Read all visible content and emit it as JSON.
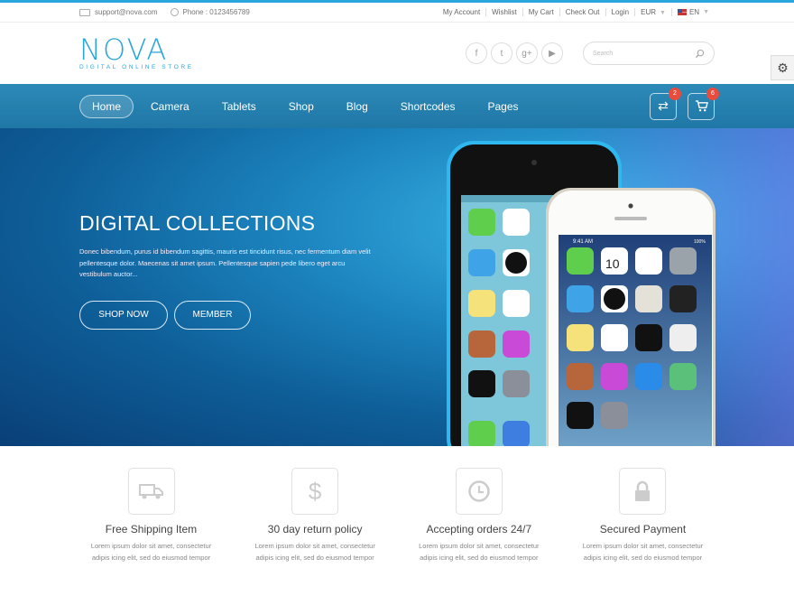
{
  "topbar": {
    "email": "support@nova.com",
    "phone": "Phone : 0123456789",
    "links": [
      "My Account",
      "Wishlist",
      "My Cart",
      "Check Out",
      "Login"
    ],
    "currency": "EUR",
    "language": "EN"
  },
  "logo": {
    "brand": "NOVA",
    "tagline": "DIGITAL ONLINE STORE"
  },
  "search": {
    "placeholder": "Search"
  },
  "nav": {
    "items": [
      "Home",
      "Camera",
      "Tablets",
      "Shop",
      "Blog",
      "Shortcodes",
      "Pages"
    ],
    "compare_count": "2",
    "cart_count": "6"
  },
  "hero": {
    "title": "DIGITAL COLLECTIONS",
    "text": "Donec bibendum, purus id bibendum sagittis, mauris est tincidunt risus, nec fermentum diam velit pellentesque dolor. Maecenas sit amet ipsum. Pellentesque sapien pede libero eget arcu vestibulum auctor...",
    "btn1": "SHOP NOW",
    "btn2": "MEMBER"
  },
  "phone_screen": {
    "time": "9:41 AM",
    "battery": "100%",
    "date_number": "10",
    "apps": [
      "Messages",
      "Calendar",
      "Photos",
      "Camera",
      "Weather",
      "Clock",
      "Maps",
      "Videos",
      "Notes",
      "Reminders",
      "Stocks",
      "Game Center",
      "Newsstand",
      "iTunes Store",
      "App Store",
      "Passbook",
      "Compass",
      "Settings"
    ]
  },
  "features": [
    {
      "title": "Free Shipping Item",
      "text": "Lorem ipsum dolor sit amet, consectetur adipis icing elit, sed do eiusmod tempor",
      "icon": "truck-icon"
    },
    {
      "title": "30 day return policy",
      "text": "Lorem ipsum dolor sit amet, consectetur adipis icing elit, sed do eiusmod tempor",
      "icon": "dollar-icon"
    },
    {
      "title": "Accepting orders 24/7",
      "text": "Lorem ipsum dolor sit amet, consectetur adipis icing elit, sed do eiusmod tempor",
      "icon": "clock-icon"
    },
    {
      "title": "Secured Payment",
      "text": "Lorem ipsum dolor sit amet, consectetur adipis icing elit, sed do eiusmod tempor",
      "icon": "lock-icon"
    }
  ],
  "colors": {
    "accent": "#2aa6dc",
    "nav": "#1f77a6",
    "badge": "#e84c3d"
  }
}
